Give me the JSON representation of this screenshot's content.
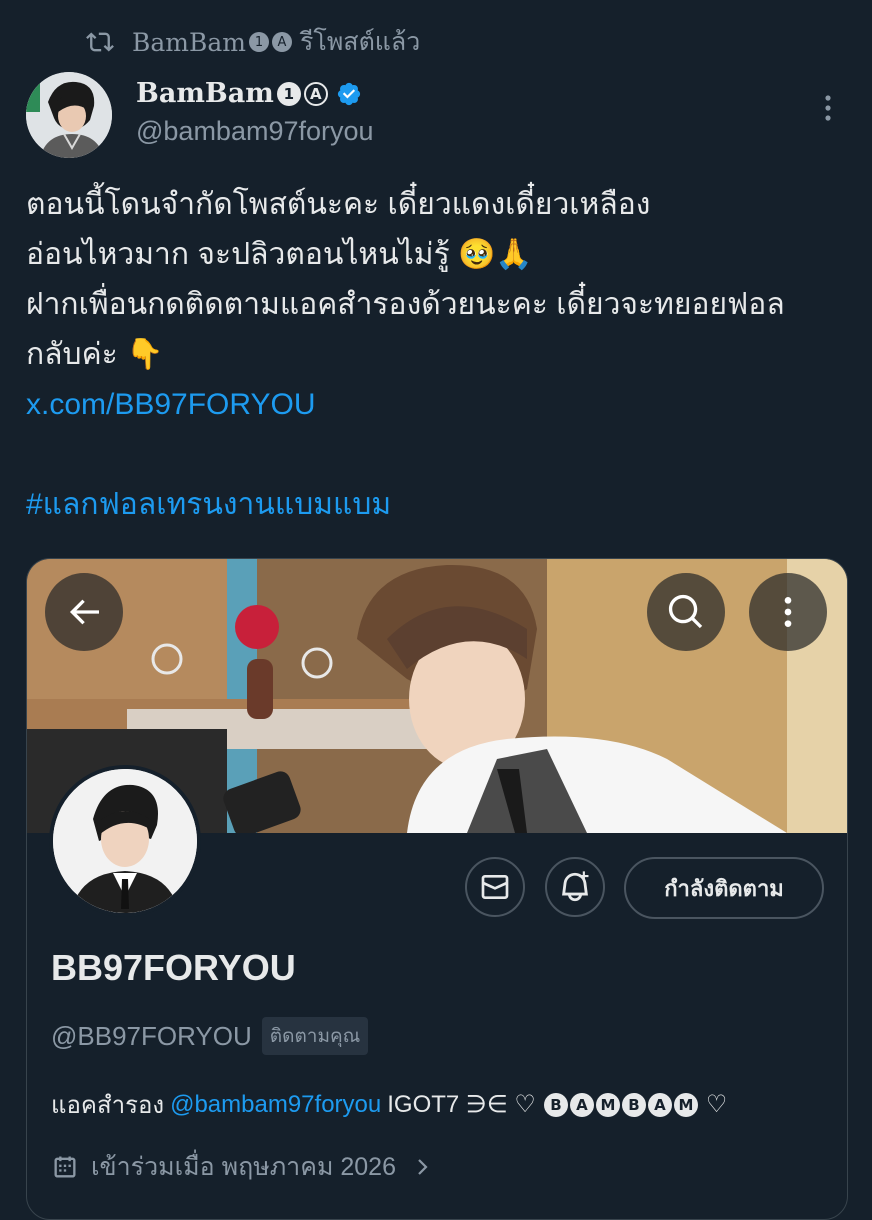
{
  "retweet": {
    "name_prefix": "BamBam",
    "badge_1": "1",
    "badge_a": "A",
    "label": "รีโพสต์แล้ว"
  },
  "author": {
    "name": "BamBam",
    "badge_1": "1",
    "badge_a": "A",
    "handle": "@bambam97foryou"
  },
  "tweet": {
    "line1": "ตอนนี้โดนจำกัดโพสต์นะคะ เดี๋ยวแดงเดี๋ยวเหลือง",
    "line2": "อ่อนไหวมาก จะปลิวตอนไหนไม่รู้ 🥹🙏",
    "line3": "ฝากเพื่อนกดติดตามแอคสำรองด้วยนะคะ เดี๋ยวจะทยอยฟอล",
    "line4": "กลับค่ะ 👇",
    "link": "x.com/BB97FORYOU",
    "hashtag": "#แลกฟอลเทรนงานแบมแบม"
  },
  "card": {
    "display_name": "BB97FORYOU",
    "handle": "@BB97FORYOU",
    "follows_you": "ติดตามคุณ",
    "following_label": "กำลังติดตาม",
    "bio_prefix": "แอคสำรอง",
    "bio_mention": "@bambam97foryou",
    "bio_text": "IGOT7 ∋∈ ♡",
    "bio_letters": [
      "B",
      "A",
      "M",
      "B",
      "A",
      "M"
    ],
    "bio_suffix": "♡",
    "joined": "เข้าร่วมเมื่อ พฤษภาคม 2026"
  },
  "colors": {
    "background": "#15202b",
    "link": "#1d9bf0",
    "secondary_text": "#8b98a5",
    "verified": "#1d9bf0"
  },
  "icons": [
    "retweet-icon",
    "verified-icon",
    "more-icon",
    "back-arrow-icon",
    "search-icon",
    "more-vertical-icon",
    "mail-icon",
    "bell-plus-icon",
    "calendar-icon",
    "chevron-right-icon"
  ]
}
